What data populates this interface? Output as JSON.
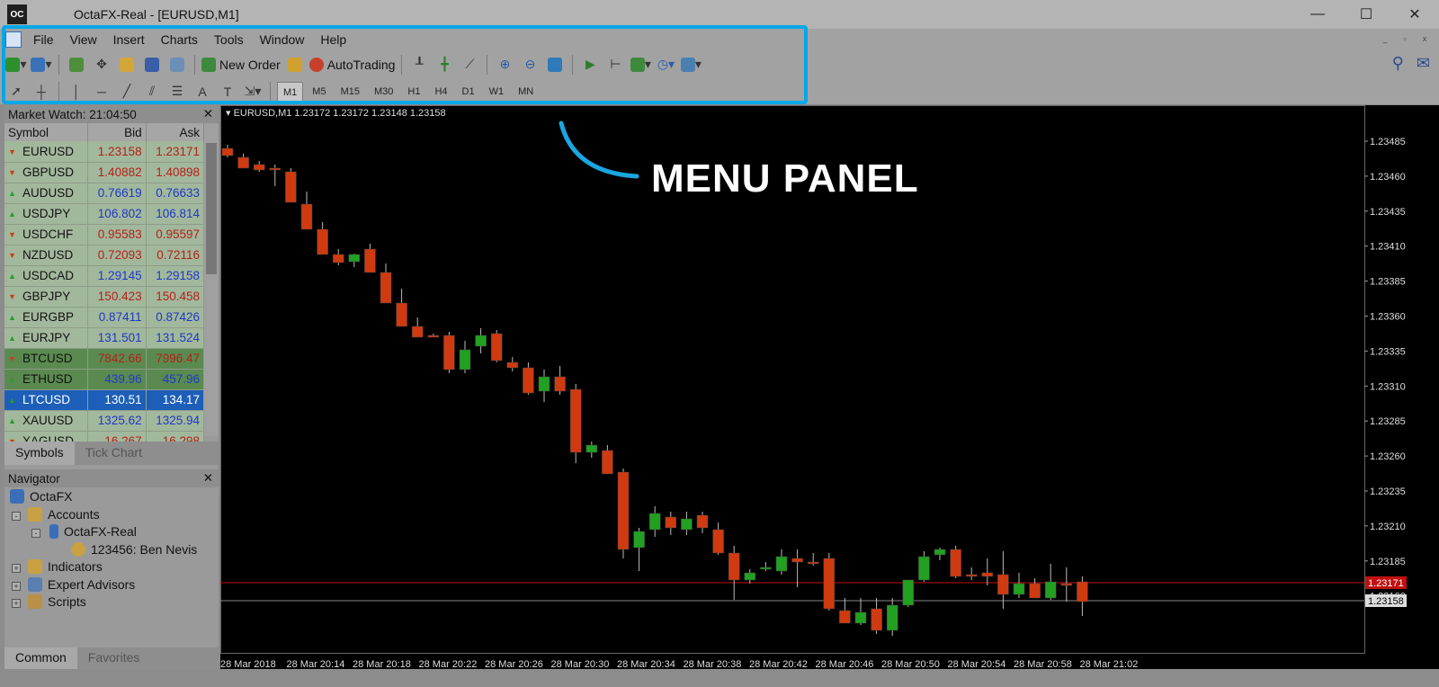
{
  "window": {
    "title": "OctaFX-Real - [EURUSD,M1]",
    "logo": "OC",
    "minimize": "—",
    "maximize": "☐",
    "close": "✕"
  },
  "menu": [
    "File",
    "View",
    "Insert",
    "Charts",
    "Tools",
    "Window",
    "Help"
  ],
  "toolbar": {
    "new_order": "New Order",
    "autotrading": "AutoTrading"
  },
  "timeframes": [
    "M1",
    "M5",
    "M15",
    "M30",
    "H1",
    "H4",
    "D1",
    "W1",
    "MN"
  ],
  "active_timeframe": "M1",
  "market_watch": {
    "title": "Market Watch: 21:04:50",
    "columns": [
      "Symbol",
      "Bid",
      "Ask"
    ],
    "rows": [
      {
        "symbol": "EURUSD",
        "bid": "1.23158",
        "ask": "1.23171",
        "dir": "down",
        "group": "fx"
      },
      {
        "symbol": "GBPUSD",
        "bid": "1.40882",
        "ask": "1.40898",
        "dir": "down",
        "group": "fx"
      },
      {
        "symbol": "AUDUSD",
        "bid": "0.76619",
        "ask": "0.76633",
        "dir": "up",
        "group": "fx"
      },
      {
        "symbol": "USDJPY",
        "bid": "106.802",
        "ask": "106.814",
        "dir": "up",
        "group": "fx"
      },
      {
        "symbol": "USDCHF",
        "bid": "0.95583",
        "ask": "0.95597",
        "dir": "down",
        "group": "fx"
      },
      {
        "symbol": "NZDUSD",
        "bid": "0.72093",
        "ask": "0.72116",
        "dir": "down",
        "group": "fx"
      },
      {
        "symbol": "USDCAD",
        "bid": "1.29145",
        "ask": "1.29158",
        "dir": "up",
        "group": "fx"
      },
      {
        "symbol": "GBPJPY",
        "bid": "150.423",
        "ask": "150.458",
        "dir": "down",
        "group": "fx"
      },
      {
        "symbol": "EURGBP",
        "bid": "0.87411",
        "ask": "0.87426",
        "dir": "up",
        "group": "fx"
      },
      {
        "symbol": "EURJPY",
        "bid": "131.501",
        "ask": "131.524",
        "dir": "up",
        "group": "fx"
      },
      {
        "symbol": "BTCUSD",
        "bid": "7842.66",
        "ask": "7996.47",
        "dir": "down",
        "group": "crypto"
      },
      {
        "symbol": "ETHUSD",
        "bid": "439.96",
        "ask": "457.96",
        "dir": "up",
        "group": "crypto"
      },
      {
        "symbol": "LTCUSD",
        "bid": "130.51",
        "ask": "134.17",
        "dir": "up",
        "group": "selected"
      },
      {
        "symbol": "XAUUSD",
        "bid": "1325.62",
        "ask": "1325.94",
        "dir": "up",
        "group": "fx"
      },
      {
        "symbol": "XAGUSD",
        "bid": "16.267",
        "ask": "16.298",
        "dir": "down",
        "group": "fx"
      }
    ],
    "tabs": [
      "Symbols",
      "Tick Chart"
    ]
  },
  "navigator": {
    "title": "Navigator",
    "items": [
      "OctaFX",
      "Accounts",
      "OctaFX-Real",
      "123456: Ben Nevis",
      "Indicators",
      "Expert Advisors",
      "Scripts"
    ],
    "tabs": [
      "Common",
      "Favorites"
    ]
  },
  "chart": {
    "info": "EURUSD,M1  1.23172 1.23172 1.23148 1.23158",
    "price_levels": [
      "1.23485",
      "1.23460",
      "1.23435",
      "1.23410",
      "1.23385",
      "1.23360",
      "1.23335",
      "1.23310",
      "1.23285",
      "1.23260",
      "1.23235",
      "1.23210",
      "1.23185",
      "1.23160"
    ],
    "ask_label": "1.23171",
    "bid_label": "1.23158",
    "time_labels": [
      "28 Mar 2018",
      "28 Mar 20:14",
      "28 Mar 20:18",
      "28 Mar 20:22",
      "28 Mar 20:26",
      "28 Mar 20:30",
      "28 Mar 20:34",
      "28 Mar 20:38",
      "28 Mar 20:42",
      "28 Mar 20:46",
      "28 Mar 20:50",
      "28 Mar 20:54",
      "28 Mar 20:58",
      "28 Mar 21:02"
    ],
    "colors": {
      "bull": "#22a022",
      "bear": "#d03a10",
      "ask_line": "#c01010",
      "bid_line": "#888888"
    }
  },
  "annotation": "MENU PANEL"
}
